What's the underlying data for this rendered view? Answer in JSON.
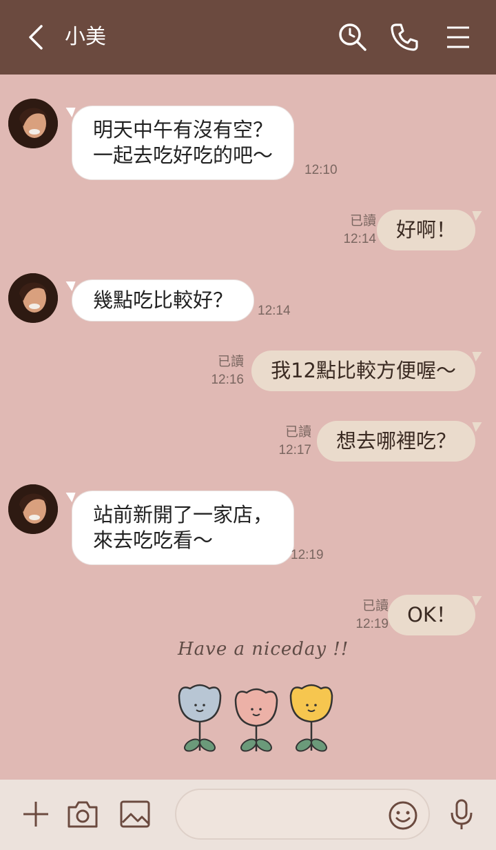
{
  "header": {
    "title": "小美"
  },
  "messages": [
    {
      "text": "明天中午有沒有空？\n一起去吃好吃的吧～",
      "time": "12:10"
    },
    {
      "text": "好啊！",
      "read": "已讀",
      "time": "12:14"
    },
    {
      "text": "幾點吃比較好？",
      "time": "12:14"
    },
    {
      "text": "我12點比較方便喔～",
      "read": "已讀",
      "time": "12:16"
    },
    {
      "text": "想去哪裡吃？",
      "read": "已讀",
      "time": "12:17"
    },
    {
      "text": "站前新開了一家店，\n來去吃吃看～",
      "time": "12:19"
    },
    {
      "text": "OK！",
      "read": "已讀",
      "time": "12:19"
    }
  ],
  "sticker": {
    "text": "Have a niceday !!"
  },
  "composer": {
    "value": ""
  },
  "colors": {
    "header_bg": "#6b4a3f",
    "chat_bg": "#e0b9b4",
    "incoming_bubble": "#ffffff",
    "outgoing_bubble": "#eadbcc",
    "bottom_bar": "#ece2dc"
  },
  "icons": {
    "header": [
      "back-icon",
      "search-icon",
      "phone-icon",
      "menu-icon"
    ],
    "composer": [
      "plus-icon",
      "camera-icon",
      "image-icon",
      "emoji-icon",
      "microphone-icon"
    ]
  }
}
